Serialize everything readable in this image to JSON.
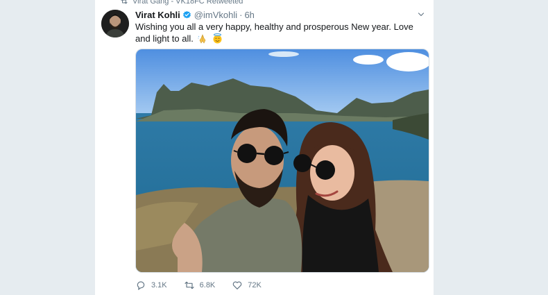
{
  "retweet_context": {
    "icon": "retweet-icon",
    "text": "Virat Gang - VK18FC Retweeted"
  },
  "tweet": {
    "display_name": "Virat Kohli",
    "handle": "@imVkohli",
    "separator": "·",
    "time": "6h",
    "text": "Wishing you all a very happy, healthy and prosperous New year. Love and light to all.",
    "emojis": [
      "folded-hands-emoji",
      "smiling-halo-emoji"
    ],
    "verified_color": "#1da1f2"
  },
  "actions": {
    "reply_count": "3.1K",
    "retweet_count": "6.8K",
    "like_count": "72K"
  },
  "colors": {
    "background": "#e6ecf0",
    "card": "#ffffff",
    "muted_text": "#657786",
    "primary_text": "#14171a"
  }
}
